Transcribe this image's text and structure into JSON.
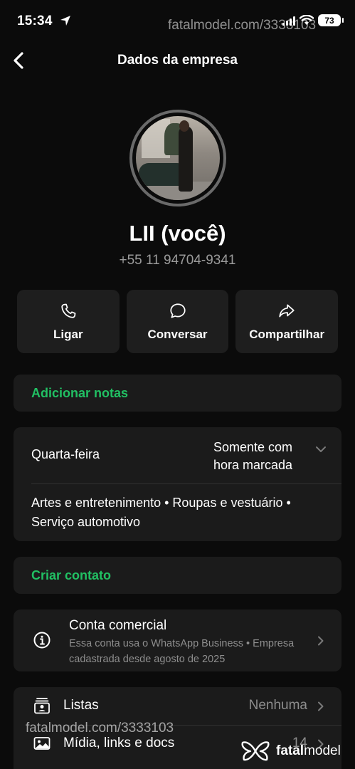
{
  "status_bar": {
    "time": "15:34",
    "battery": "73"
  },
  "watermark": {
    "top_text": "fatalmodel.com/3333103",
    "bottom_text": "fatalmodel.com/3333103",
    "logo_prefix": "fatal",
    "logo_suffix": "model"
  },
  "nav": {
    "title": "Dados da empresa"
  },
  "profile": {
    "name": "LII (você)",
    "phone": "+55 11 94704-9341"
  },
  "actions": [
    {
      "label": "Ligar",
      "icon": "phone-icon"
    },
    {
      "label": "Conversar",
      "icon": "chat-bubble-icon"
    },
    {
      "label": "Compartilhar",
      "icon": "share-arrow-icon"
    }
  ],
  "notes": {
    "label": "Adicionar notas"
  },
  "business_hours": {
    "day": "Quarta-feira",
    "status": "Somente com hora marcada"
  },
  "categories": {
    "text": "Artes e entretenimento • Roupas e vestuário • Serviço automotivo"
  },
  "create_contact": {
    "label": "Criar contato"
  },
  "business_account": {
    "title": "Conta comercial",
    "description": "Essa conta usa o WhatsApp Business • Empresa cadastrada desde agosto de 2025"
  },
  "lists": [
    {
      "label": "Listas",
      "value": "Nenhuma",
      "icon": "lists-icon"
    },
    {
      "label": "Mídia, links e docs",
      "value": "14",
      "icon": "media-icon"
    }
  ],
  "colors": {
    "accent_green": "#21c063",
    "background": "#0b0b0b",
    "card": "#1b1b1b",
    "secondary_text": "#8e8e8e"
  }
}
